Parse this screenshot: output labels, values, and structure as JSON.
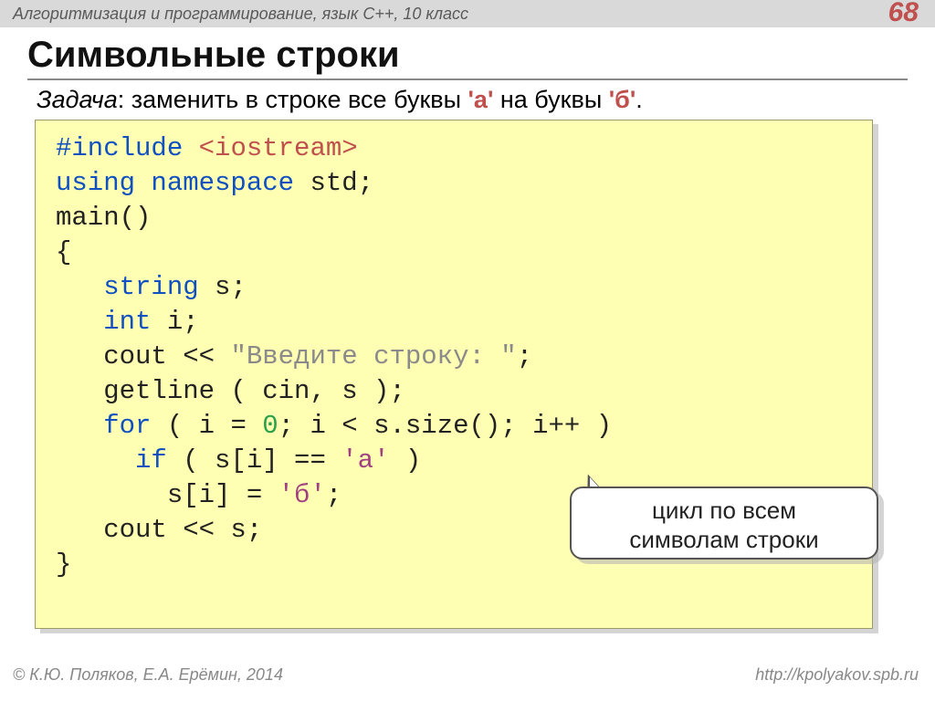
{
  "page": {
    "topbar": "Алгоритмизация и программирование, язык C++, 10 класс",
    "number": "68",
    "title": "Символьные строки"
  },
  "task": {
    "label": "Задача",
    "sep": ": ",
    "text_a": "заменить в строке все буквы ",
    "ch1": "'а'",
    "text_b": " на буквы ",
    "ch2": "'б'",
    "dot": "."
  },
  "code": {
    "l1a": "#include ",
    "l1b": "<iostream>",
    "l2a": "using",
    "l2b": " namespace ",
    "l2c": "std",
    "l2d": ";",
    "l3": "main()",
    "l4": "{",
    "l5a": "   ",
    "l5b": "string",
    "l5c": " s;",
    "l6a": "   ",
    "l6b": "int",
    "l6c": " i;",
    "l7a": "   cout << ",
    "l7b": "\"Введите строку: \"",
    "l7c": ";",
    "l8": "   getline ( cin, s );",
    "l9a": "   ",
    "l9b": "for",
    "l9c": " ( i = ",
    "l9d": "0",
    "l9e": "; i < s.size(); i++ )",
    "l10a": "     ",
    "l10b": "if",
    "l10c": " ( s[i] == ",
    "l10d": "'а'",
    "l10e": " )",
    "l11a": "       s[i] = ",
    "l11b": "'б'",
    "l11c": ";",
    "l12": "   cout << s;",
    "l13": "}"
  },
  "callout": {
    "line1": "цикл по всем",
    "line2": "символам строки"
  },
  "footer": {
    "left": "© К.Ю. Поляков, Е.А. Ерёмин, 2014",
    "right": "http://kpolyakov.spb.ru"
  }
}
